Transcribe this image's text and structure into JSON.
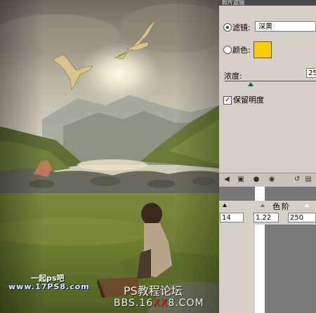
{
  "panel": {
    "title": "照片滤镜",
    "filter_label": "滤镜:",
    "filter_value": "深黄",
    "color_label": "颜色:",
    "color_value": "#ffcc00",
    "density_label": "浓度:",
    "density_value": "25",
    "preserve_label": "保留明度"
  },
  "levels": {
    "title": "色阶",
    "inputs": [
      "14",
      "1.22",
      "250"
    ]
  },
  "watermarks": {
    "logo_top": "一起ps吧",
    "logo_bottom": "www.17PS8.com",
    "forum": "PS教程论坛",
    "bbs_prefix": "BBS.16",
    "bbs_red": "XX",
    "bbs_suffix": "8.COM"
  },
  "toolbar": {
    "icons": [
      "back-arrow-icon",
      "layer-icon",
      "mask-icon",
      "eye-icon",
      "reset-icon",
      "delete-icon"
    ]
  }
}
